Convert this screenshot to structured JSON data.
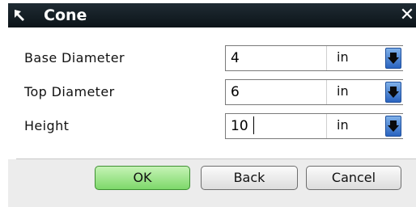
{
  "window": {
    "title": "Cone",
    "close_glyph": "✕"
  },
  "fields": [
    {
      "label": "Base Diameter",
      "value": "4",
      "unit": "in"
    },
    {
      "label": "Top Diameter",
      "value": "6",
      "unit": "in"
    },
    {
      "label": "Height",
      "value": "10",
      "unit": "in"
    }
  ],
  "buttons": {
    "ok": "OK",
    "back": "Back",
    "cancel": "Cancel"
  },
  "colors": {
    "titlebar": "#0c1419",
    "ok_button": "#7dd86a",
    "dropdown_arrow": "#2a64c0"
  },
  "icons": {
    "title_grip": "grip-arrow-icon",
    "close": "close-icon",
    "dropdown": "chevron-down-icon"
  }
}
